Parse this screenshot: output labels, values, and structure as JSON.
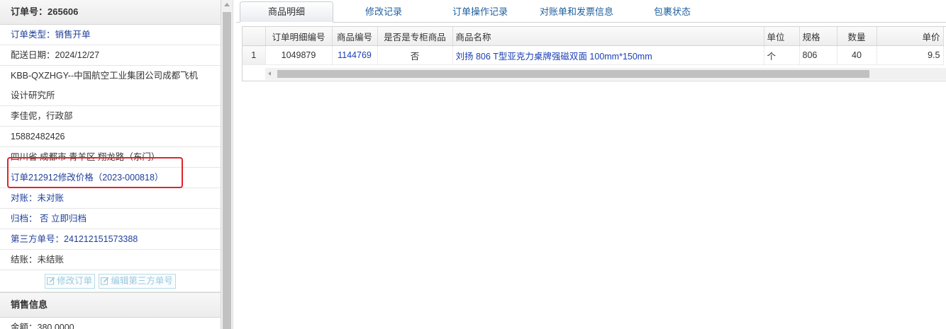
{
  "left_panel": {
    "order_header": "订单号：265606",
    "rows": [
      {
        "text": "订单类型：销售开单",
        "style": "blue"
      },
      {
        "text": "配送日期：2024/12/27",
        "style": "plain"
      },
      {
        "text": "KBB-QXZHGY--中国航空工业集团公司成都飞机",
        "style": "plain"
      },
      {
        "text": "设计研究所",
        "style": "plain"
      },
      {
        "text": "李佳伲，行政部",
        "style": "plain"
      },
      {
        "text": "15882482426",
        "style": "plain"
      },
      {
        "text": "四川省 成都市 青羊区 翔龙路（东门）",
        "style": "plain"
      },
      {
        "text": "订单212912修改价格（2023-000818）",
        "style": "blue"
      },
      {
        "text": "对账：未对账",
        "style": "blue"
      },
      {
        "text": "归档： 否 立即归档",
        "style": "blue"
      },
      {
        "text": "第三方单号：241212151573388",
        "style": "blue"
      },
      {
        "text": "结账：未结账",
        "style": "plain"
      }
    ],
    "buttons": {
      "edit_order": "修改订单",
      "edit_third_party": "编辑第三方单号"
    },
    "sales_section": {
      "title": "销售信息",
      "amount": "金额：380.0000"
    },
    "annotation_color": "#e0242a"
  },
  "tabs": [
    {
      "label": "商品明细",
      "active": true
    },
    {
      "label": "修改记录",
      "active": false
    },
    {
      "label": "订单操作记录",
      "active": false
    },
    {
      "label": "对账单和发票信息",
      "active": false
    },
    {
      "label": "包裹状态",
      "active": false
    }
  ],
  "grid": {
    "columns": [
      "",
      "订单明细编号",
      "商品编号",
      "是否是专柜商品",
      "商品名称",
      "单位",
      "规格",
      "数量",
      "单价"
    ],
    "rows": [
      {
        "row_num": "1",
        "detail_id": "1049879",
        "product_id": "1144769",
        "is_counter": "否",
        "name": "刘扬 806 T型亚克力桌牌强磁双面 100mm*150mm",
        "unit": "个",
        "spec": "806",
        "qty": "40",
        "price": "9.5"
      }
    ]
  },
  "colors": {
    "link": "#1a3fb5",
    "tab_text": "#1f5f9e",
    "annotation": "#e0242a"
  }
}
